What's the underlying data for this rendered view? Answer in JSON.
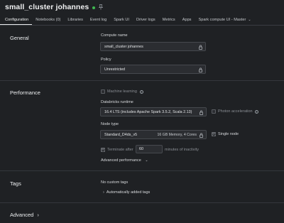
{
  "header": {
    "title": "small_cluster johannes",
    "status_color": "#3fb950",
    "tabs": [
      {
        "label": "Configuration",
        "active": true
      },
      {
        "label": "Notebooks (0)"
      },
      {
        "label": "Libraries"
      },
      {
        "label": "Event log"
      },
      {
        "label": "Spark UI"
      },
      {
        "label": "Driver logs"
      },
      {
        "label": "Metrics"
      },
      {
        "label": "Apps"
      },
      {
        "label": "Spark compute UI - Master"
      }
    ]
  },
  "general": {
    "title": "General",
    "compute_name_label": "Compute name",
    "compute_name_value": "small_cluster johannes",
    "policy_label": "Policy",
    "policy_value": "Unrestricted"
  },
  "performance": {
    "title": "Performance",
    "machine_learning_label": "Machine learning",
    "runtime_label": "Databricks runtime",
    "runtime_value": "16.4 LTS (includes Apache Spark 3.5.2, Scala 2.13)",
    "photon_label": "Photon acceleration",
    "node_type_label": "Node type",
    "node_type_value": "Standard_D4ds_v5",
    "node_type_specs": "16 GB Memory, 4 Cores",
    "single_node_label": "Single node",
    "terminate_label": "Terminate after",
    "terminate_value": "60",
    "terminate_suffix": "minutes of inactivity",
    "advanced_performance_label": "Advanced performance"
  },
  "tags": {
    "title": "Tags",
    "no_tags_text": "No custom tags",
    "auto_tags_label": "Automatically added tags"
  },
  "advanced": {
    "title": "Advanced"
  }
}
